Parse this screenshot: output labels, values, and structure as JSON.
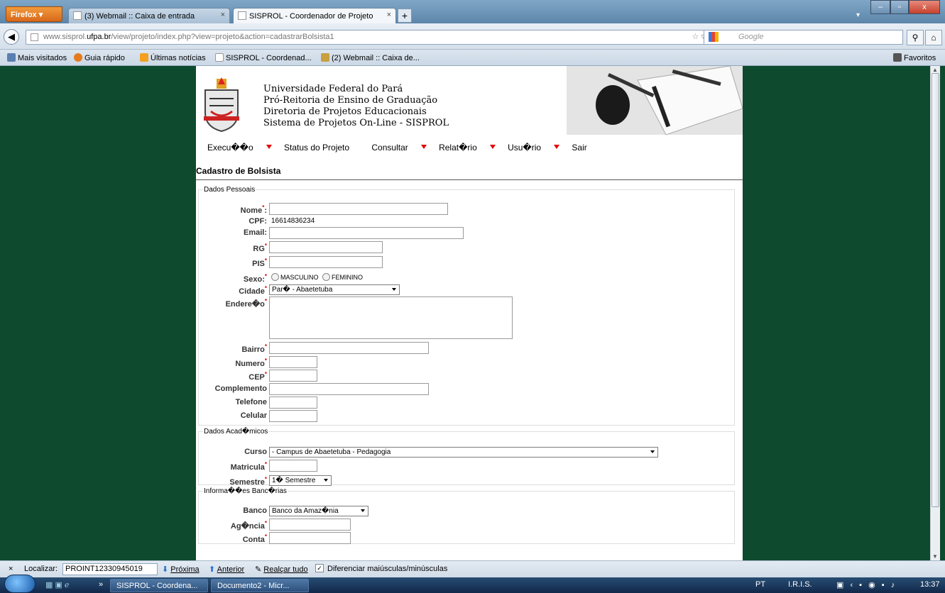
{
  "browser": {
    "menu_button": "Firefox",
    "tabs": [
      {
        "label": "(3) Webmail :: Caixa de entrada",
        "close": "×"
      },
      {
        "label": "SISPROL - Coordenador de Projeto",
        "close": "×"
      }
    ],
    "new_tab": "+",
    "window_controls": {
      "minimize": "–",
      "maximize": "▫",
      "close": "x"
    },
    "tab_dropdown": "▾",
    "url_prefix": "www.sisprol.",
    "url_domain": "ufpa.br",
    "url_rest": "/view/projeto/index.php?view=projeto&action=cadastrarBolsista1",
    "url_right": "☆ ▿ C",
    "search_placeholder": "Google",
    "bookmarks": [
      "Mais visitados",
      "Guia rápido",
      "Últimas notícias",
      "SISPROL - Coordenad...",
      "(2) Webmail :: Caixa de..."
    ],
    "favorites": "Favoritos"
  },
  "header": {
    "lines": [
      "Universidade Federal do Pará",
      "Pró-Reitoria de Ensino de Graduação",
      "Diretoria de Projetos Educacionais",
      "Sistema de Projetos On-Line - SISPROL"
    ]
  },
  "menu": {
    "items": [
      {
        "label": "Execu��o",
        "dropdown": true
      },
      {
        "label": "Status do Projeto",
        "dropdown": false
      },
      {
        "label": "Consultar",
        "dropdown": true
      },
      {
        "label": "Relat�rio",
        "dropdown": true
      },
      {
        "label": "Usu�rio",
        "dropdown": true
      },
      {
        "label": "Sair",
        "dropdown": false
      }
    ]
  },
  "page_title": "Cadastro de Bolsista",
  "dados_pessoais": {
    "legend": "Dados Pessoais",
    "nome": "Nome",
    "cpf_label": "CPF:",
    "cpf_value": "16614836234",
    "email": "Email:",
    "rg": "RG",
    "pis": "PIS",
    "sexo": "Sexo:",
    "sexo_opts": [
      "MASCULINO",
      "FEMININO"
    ],
    "cidade": "Cidade",
    "cidade_value": "Par� - Abaetetuba",
    "endereco": "Endere�o",
    "bairro": "Bairro",
    "numero": "Numero",
    "cep": "CEP",
    "complemento": "Complemento",
    "telefone": "Telefone",
    "celular": "Celular"
  },
  "dados_academicos": {
    "legend": "Dados Acad�micos",
    "curso": "Curso",
    "curso_value": "- Campus de Abaetetuba - Pedagogia",
    "matricula": "Matricula",
    "semestre": "Semestre",
    "semestre_value": "1� Semestre"
  },
  "bancarias": {
    "legend": "Informa��es Banc�rias",
    "banco": "Banco",
    "banco_value": "Banco da Amaz�nia",
    "agencia": "Ag�ncia",
    "conta": "Conta"
  },
  "findbar": {
    "close": "×",
    "label": "Localizar:",
    "value": "PROINT12330945019",
    "next": "Próxima",
    "prev": "Anterior",
    "highlight": "Realçar tudo",
    "match_case": "Diferenciar maiúsculas/minúsculas"
  },
  "taskbar": {
    "quick": "»",
    "apps": [
      "SISPROL - Coordena...",
      "Documento2 - Micr..."
    ],
    "lang": "PT",
    "iris": "I.R.I.S.",
    "time": "13:37"
  },
  "colors": {
    "background": "#0d4a2e",
    "required": "#e10000",
    "menu_arrow": "#e10000"
  }
}
